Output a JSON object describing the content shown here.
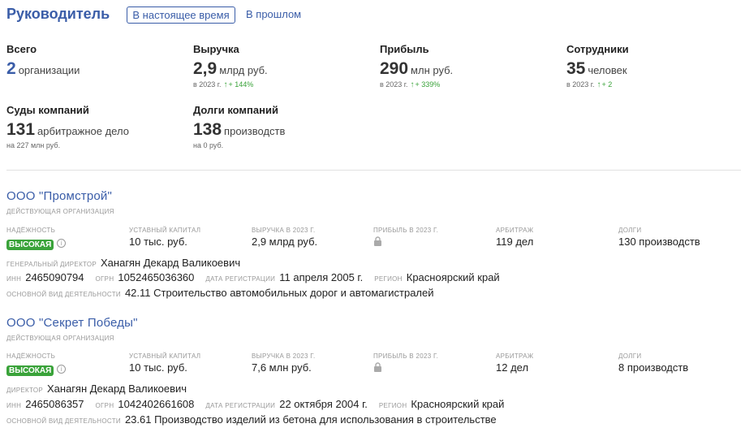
{
  "header": {
    "title": "Руководитель",
    "tab_current": "В настоящее время",
    "tab_past": "В прошлом"
  },
  "stats": {
    "total": {
      "label": "Всего",
      "value": "2",
      "unit": "организации"
    },
    "revenue": {
      "label": "Выручка",
      "value": "2,9",
      "unit": "млрд руб.",
      "sub_year": "в 2023 г.",
      "sub_delta": "+ 144%"
    },
    "profit": {
      "label": "Прибыль",
      "value": "290",
      "unit": "млн руб.",
      "sub_year": "в 2023 г.",
      "sub_delta": "+ 339%"
    },
    "employees": {
      "label": "Сотрудники",
      "value": "35",
      "unit": "человек",
      "sub_year": "в 2023 г.",
      "sub_delta": "+ 2"
    },
    "courts": {
      "label": "Суды компаний",
      "value": "131",
      "unit": "арбитражное дело",
      "sub": "на 227 млн руб."
    },
    "debts": {
      "label": "Долги компаний",
      "value": "138",
      "unit": "производств",
      "sub": "на 0 руб."
    }
  },
  "columns": {
    "reliability": "Надёжность",
    "capital": "Уставный капитал",
    "revenue": "Выручка в 2023 г.",
    "profit": "Прибыль в 2023 г.",
    "arbitration": "Арбитраж",
    "debts": "Долги"
  },
  "labels": {
    "general_director": "Генеральный директор",
    "director": "Директор",
    "inn": "ИНН",
    "ogrn": "ОГРН",
    "reg_date": "Дата регистрации",
    "region": "Регион",
    "activity": "Основной вид деятельности"
  },
  "orgs": [
    {
      "name": "ООО \"Промстрой\"",
      "status": "Действующая организация",
      "reliability": "Высокая",
      "capital": "10 тыс. руб.",
      "revenue": "2,9 млрд руб.",
      "arbitration": "119 дел",
      "debts": "130 производств",
      "director": "Ханагян Декард Валикоевич",
      "inn": "2465090794",
      "ogrn": "1052465036360",
      "reg_date": "11 апреля 2005 г.",
      "region": "Красноярский край",
      "activity": "42.11 Строительство автомобильных дорог и автомагистралей"
    },
    {
      "name": "ООО \"Секрет Победы\"",
      "status": "Действующая организация",
      "reliability": "Высокая",
      "capital": "10 тыс. руб.",
      "revenue": "7,6 млн руб.",
      "arbitration": "12 дел",
      "debts": "8 производств",
      "director": "Ханагян Декард Валикоевич",
      "inn": "2465086357",
      "ogrn": "1042402661608",
      "reg_date": "22 октября 2004 г.",
      "region": "Красноярский край",
      "activity": "23.61 Производство изделий из бетона для использования в строительстве"
    }
  ],
  "colors": {
    "accent": "#3a5da8",
    "positive": "#3aa33a"
  },
  "icons": {
    "lock": "lock-icon",
    "info": "info-icon",
    "arrow": "arrow-up-icon"
  }
}
